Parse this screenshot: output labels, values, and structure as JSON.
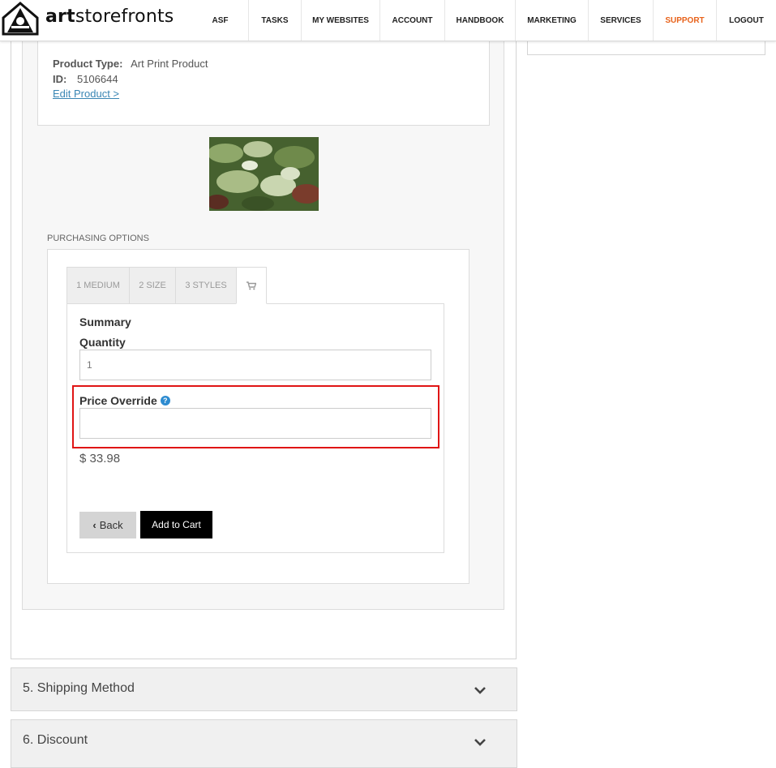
{
  "brand": {
    "name_bold": "art",
    "name_rest": "storefronts"
  },
  "nav": {
    "items": [
      {
        "label": "ASF"
      },
      {
        "label": "TASKS"
      },
      {
        "label": "MY WEBSITES"
      },
      {
        "label": "ACCOUNT"
      },
      {
        "label": "HANDBOOK"
      },
      {
        "label": "MARKETING"
      },
      {
        "label": "SERVICES"
      },
      {
        "label": "SUPPORT"
      },
      {
        "label": "LOGOUT"
      }
    ]
  },
  "product": {
    "type_label": "Product Type:",
    "type_value": "Art Print Product",
    "id_label": "ID:",
    "id_value": "5106644",
    "edit_link": "Edit Product >"
  },
  "purchasing": {
    "section_label": "PURCHASING OPTIONS",
    "tabs": [
      {
        "label": "1 MEDIUM"
      },
      {
        "label": "2 SIZE"
      },
      {
        "label": "3 STYLES"
      },
      {
        "icon": "cart-icon"
      }
    ],
    "summary_title": "Summary",
    "quantity_label": "Quantity",
    "quantity_value": "1",
    "price_override_label": "Price Override",
    "price_override_value": "",
    "price": "$ 33.98",
    "back_label": "Back",
    "add_to_cart_label": "Add to Cart"
  },
  "accordion": [
    {
      "title": "5. Shipping Method"
    },
    {
      "title": "6. Discount"
    }
  ],
  "colors": {
    "support_accent": "#e8621a",
    "highlight": "#e01515",
    "link": "#3a86b4",
    "help_icon": "#2d8bd0"
  }
}
